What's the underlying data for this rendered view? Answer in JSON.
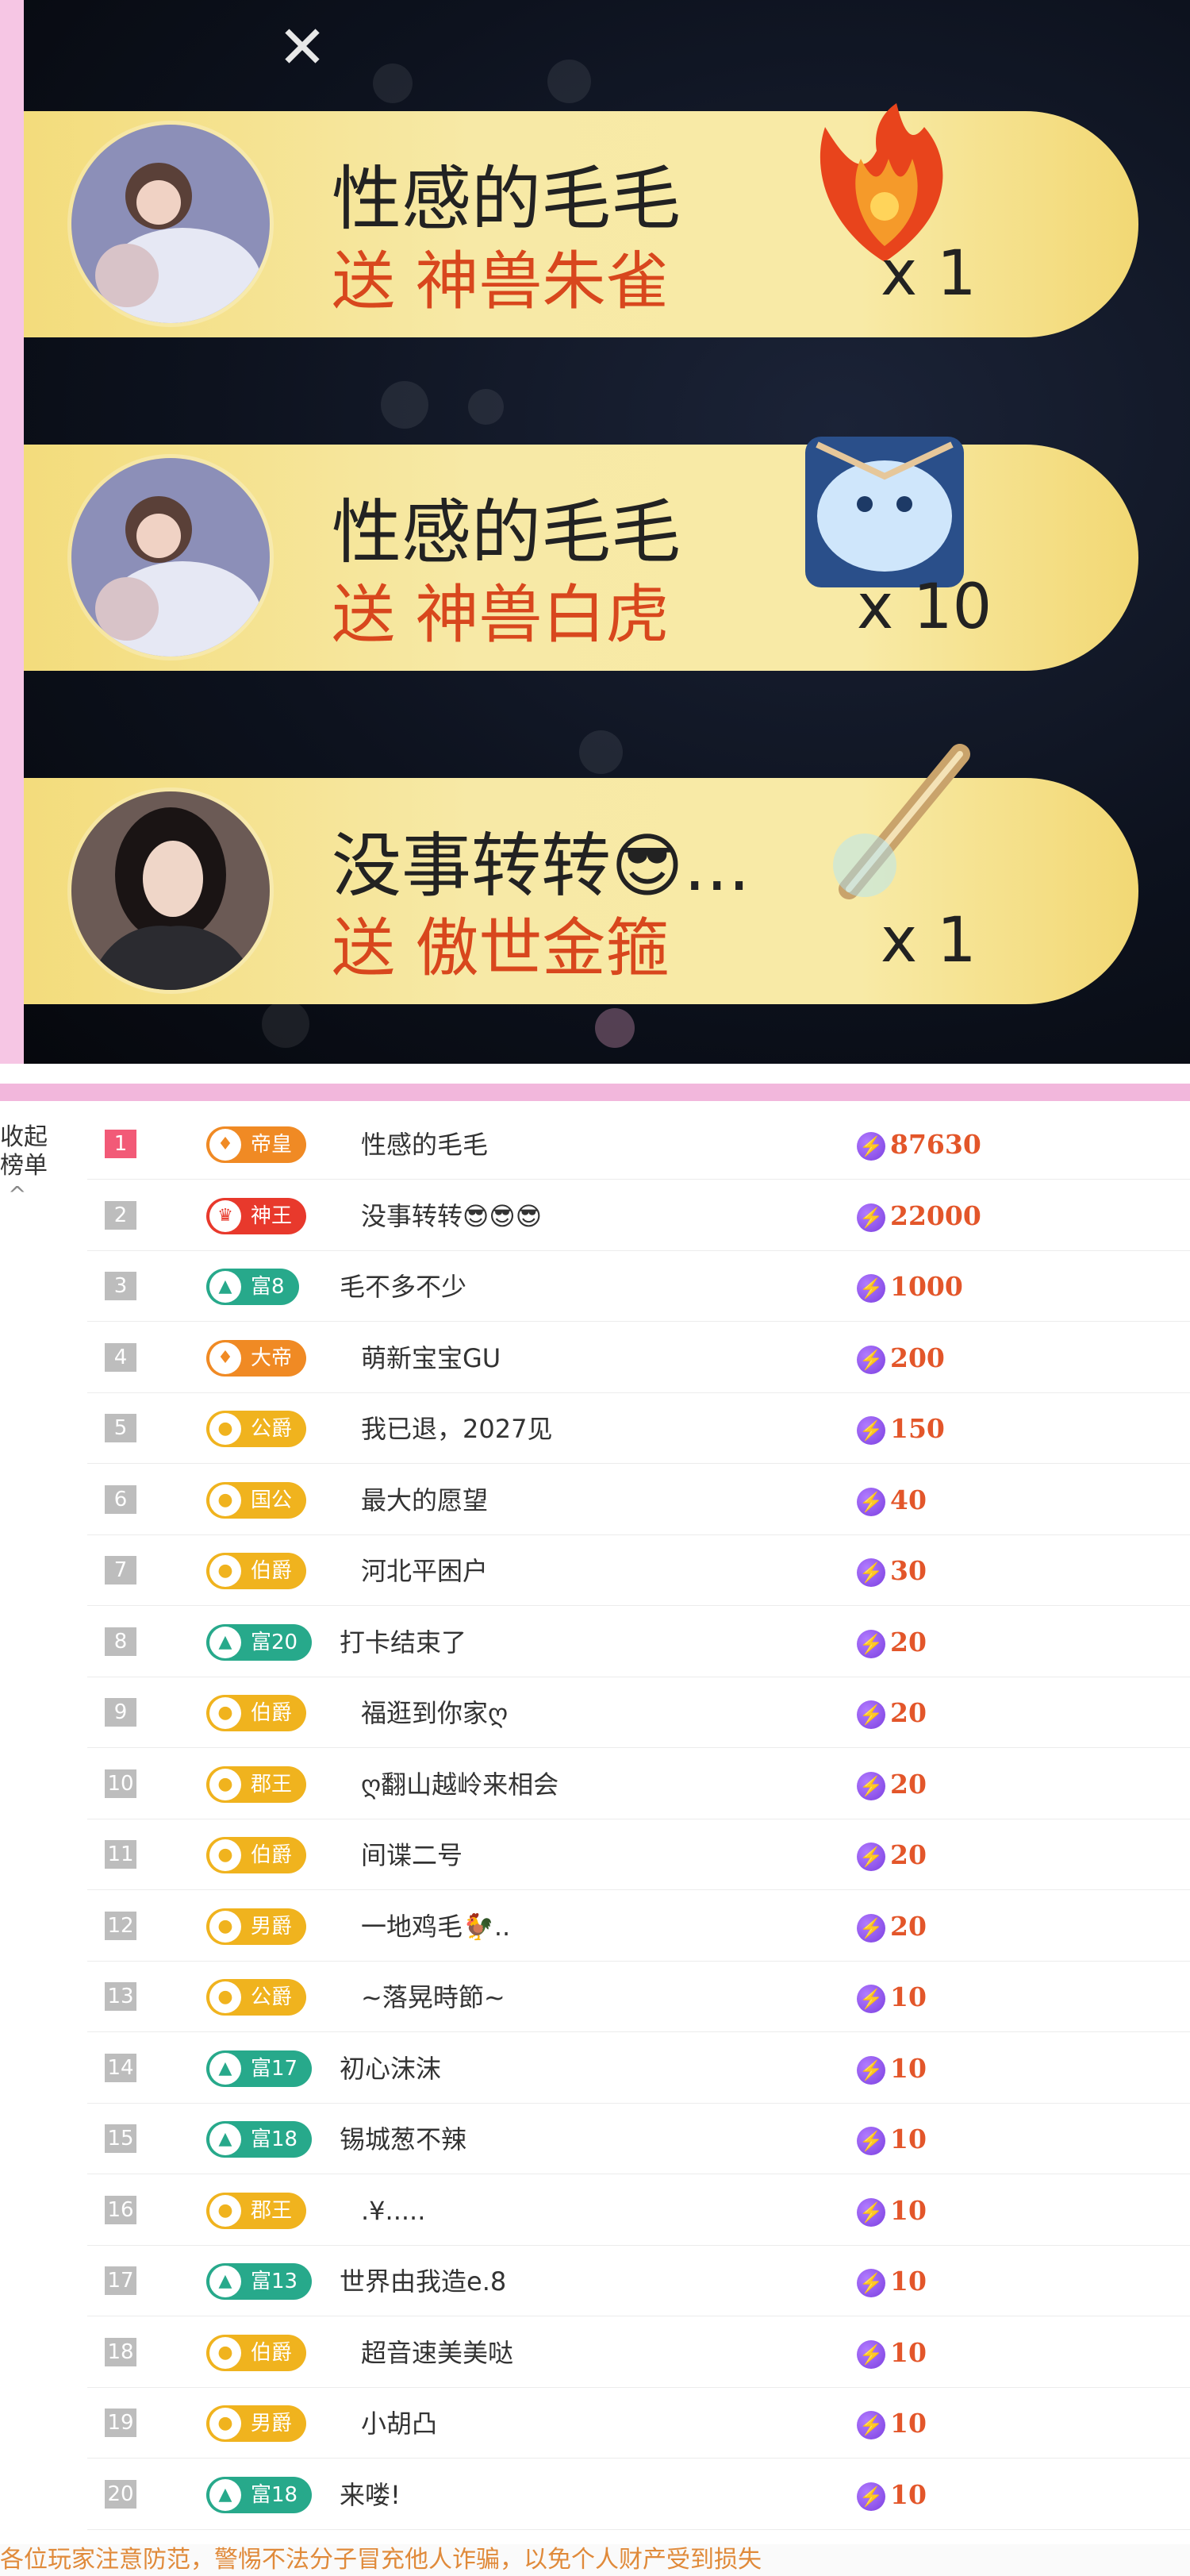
{
  "gifts": [
    {
      "sender": "性感的毛毛",
      "action": "送 神兽朱雀",
      "count": "x 1",
      "gift_icon": "phoenix-icon"
    },
    {
      "sender": "性感的毛毛",
      "action": "送 神兽白虎",
      "count": "x 10",
      "gift_icon": "white-tiger-icon"
    },
    {
      "sender": "没事转转😎...",
      "action": "送 傲世金箍",
      "count": "x 1",
      "gift_icon": "golden-staff-icon"
    }
  ],
  "close_symbol": "✕",
  "leaderboard": {
    "collapse_label": "收起\n榜单",
    "collapse_icon": "^",
    "rows": [
      {
        "rank": "1",
        "badge": "帝皇",
        "badge_color": "orange",
        "badge_icon": "♦",
        "name": "性感的毛毛",
        "score": "87630"
      },
      {
        "rank": "2",
        "badge": "神王",
        "badge_color": "red",
        "badge_icon": "♛",
        "name": "没事转转😎😎😎",
        "score": "22000"
      },
      {
        "rank": "3",
        "badge": "富8",
        "badge_color": "teal",
        "badge_icon": "▲",
        "name": "毛不多不少",
        "score": "1000"
      },
      {
        "rank": "4",
        "badge": "大帝",
        "badge_color": "orange",
        "badge_icon": "♦",
        "name": "萌新宝宝GU",
        "score": "200"
      },
      {
        "rank": "5",
        "badge": "公爵",
        "badge_color": "gold",
        "badge_icon": "●",
        "name": "我已退，2027见",
        "score": "150"
      },
      {
        "rank": "6",
        "badge": "国公",
        "badge_color": "gold",
        "badge_icon": "●",
        "name": "最大的愿望",
        "score": "40"
      },
      {
        "rank": "7",
        "badge": "伯爵",
        "badge_color": "gold",
        "badge_icon": "●",
        "name": "河北平困户",
        "score": "30"
      },
      {
        "rank": "8",
        "badge": "富20",
        "badge_color": "teal",
        "badge_icon": "▲",
        "name": "打卡结束了",
        "score": "20"
      },
      {
        "rank": "9",
        "badge": "伯爵",
        "badge_color": "gold",
        "badge_icon": "●",
        "name": "福逛到你家ღ",
        "score": "20"
      },
      {
        "rank": "10",
        "badge": "郡王",
        "badge_color": "gold",
        "badge_icon": "●",
        "name": "ღ翻山越岭来相会",
        "score": "20"
      },
      {
        "rank": "11",
        "badge": "伯爵",
        "badge_color": "gold",
        "badge_icon": "●",
        "name": "间谍二号",
        "score": "20"
      },
      {
        "rank": "12",
        "badge": "男爵",
        "badge_color": "gold",
        "badge_icon": "●",
        "name": "一地鸡毛🐓..",
        "score": "20"
      },
      {
        "rank": "13",
        "badge": "公爵",
        "badge_color": "gold",
        "badge_icon": "●",
        "name": "~落晃時節~",
        "score": "10"
      },
      {
        "rank": "14",
        "badge": "富17",
        "badge_color": "teal",
        "badge_icon": "▲",
        "name": "初心沫沫",
        "score": "10"
      },
      {
        "rank": "15",
        "badge": "富18",
        "badge_color": "teal",
        "badge_icon": "▲",
        "name": "锡城葱不辣",
        "score": "10"
      },
      {
        "rank": "16",
        "badge": "郡王",
        "badge_color": "gold",
        "badge_icon": "●",
        "name": ".¥.....",
        "score": "10"
      },
      {
        "rank": "17",
        "badge": "富13",
        "badge_color": "teal",
        "badge_icon": "▲",
        "name": "世界由我造e.8",
        "score": "10"
      },
      {
        "rank": "18",
        "badge": "伯爵",
        "badge_color": "gold",
        "badge_icon": "●",
        "name": "超音速美美哒",
        "score": "10"
      },
      {
        "rank": "19",
        "badge": "男爵",
        "badge_color": "gold",
        "badge_icon": "●",
        "name": "小胡凸",
        "score": "10"
      },
      {
        "rank": "20",
        "badge": "富18",
        "badge_color": "teal",
        "badge_icon": "▲",
        "name": "来喽!",
        "score": "10"
      }
    ]
  },
  "footer_note": "各位玩家注意防范，警惕不法分子冒充他人诈骗，以免个人财产受到损失"
}
